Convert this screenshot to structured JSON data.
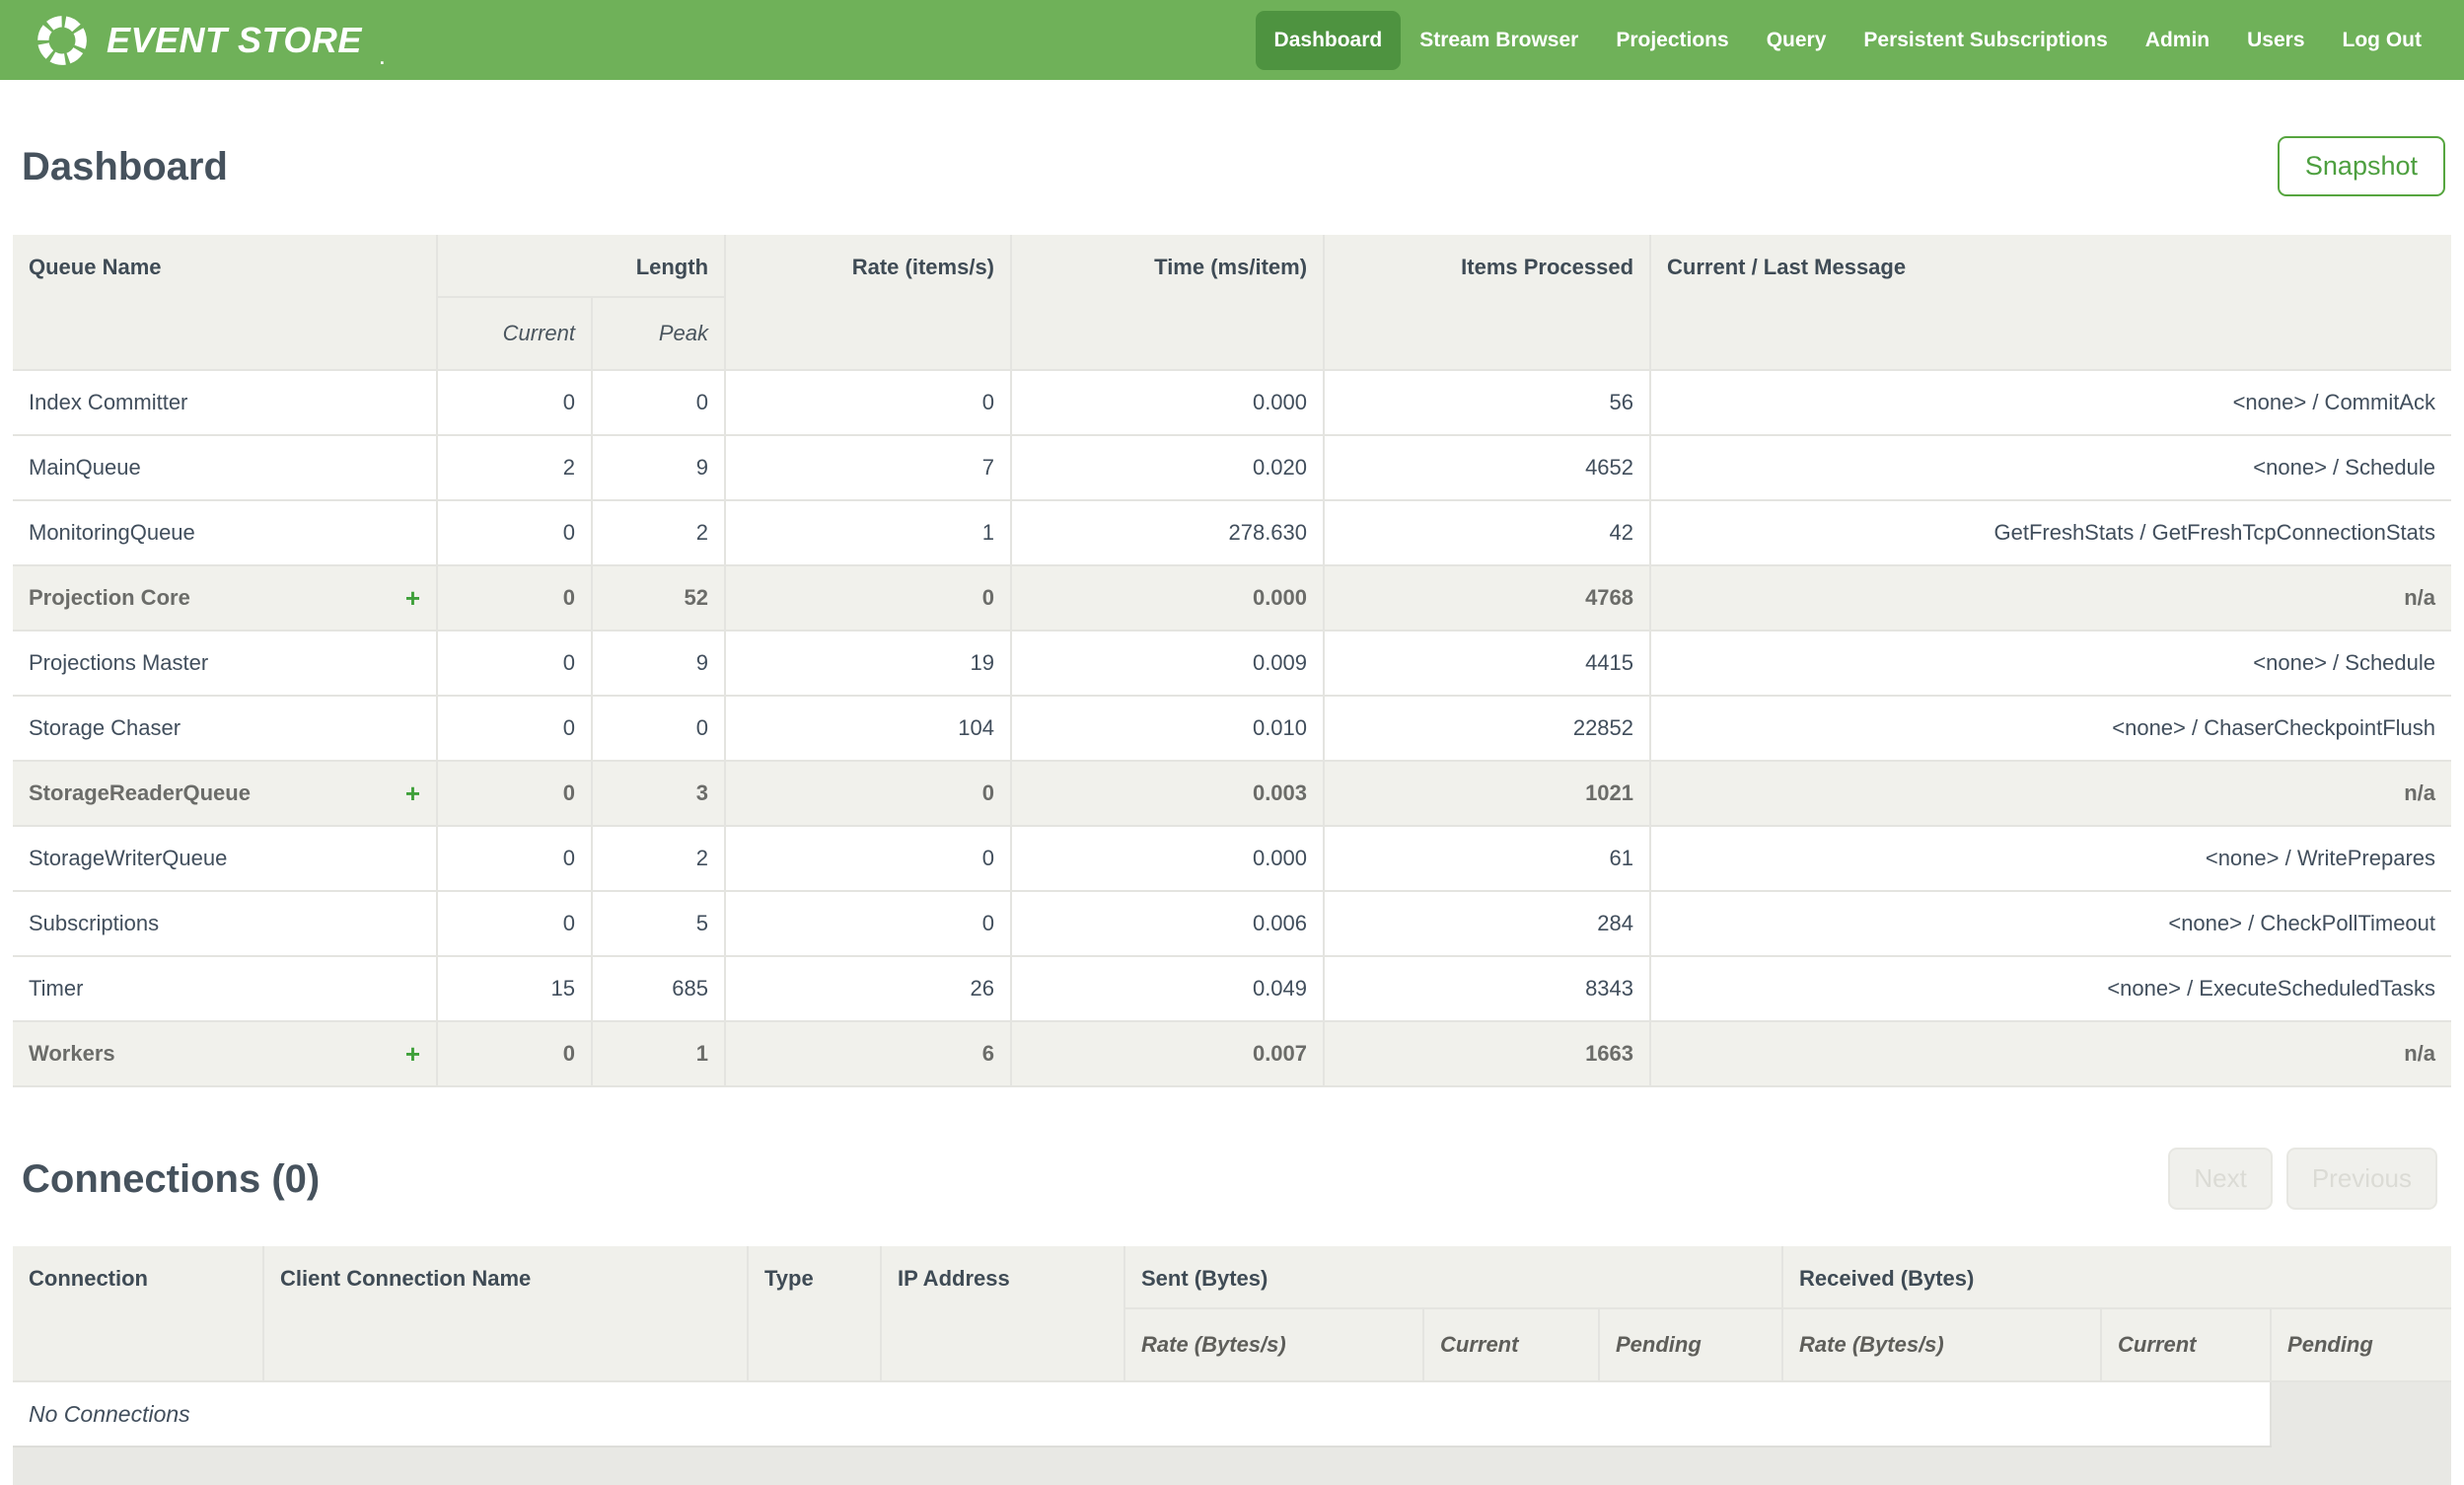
{
  "colors": {
    "nav_green": "#6FB159",
    "nav_active_green": "#4E9340",
    "accent_green": "#4D9F3F",
    "heading_text": "#46525D",
    "body_text": "#414E5C",
    "group_text": "#6B6C69",
    "header_bg": "#F0F0EB",
    "group_row_bg": "#F1F1EC"
  },
  "nav": {
    "logo_text": "EVENT STORE",
    "logo_mark": ".",
    "items": [
      {
        "label": "Dashboard",
        "active": true
      },
      {
        "label": "Stream Browser",
        "active": false
      },
      {
        "label": "Projections",
        "active": false
      },
      {
        "label": "Query",
        "active": false
      },
      {
        "label": "Persistent Subscriptions",
        "active": false
      },
      {
        "label": "Admin",
        "active": false
      },
      {
        "label": "Users",
        "active": false
      },
      {
        "label": "Log Out",
        "active": false
      }
    ]
  },
  "dashboard": {
    "title": "Dashboard",
    "snapshot_label": "Snapshot"
  },
  "queue_table": {
    "expand_symbol": "+",
    "headers": {
      "queue_name": "Queue Name",
      "length": "Length",
      "current": "Current",
      "peak": "Peak",
      "rate": "Rate (items/s)",
      "time": "Time (ms/item)",
      "items_processed": "Items Processed",
      "message": "Current / Last Message"
    },
    "rows": [
      {
        "name": "Index Committer",
        "group": false,
        "current": "0",
        "peak": "0",
        "rate": "0",
        "time": "0.000",
        "items": "56",
        "message": "<none> / CommitAck"
      },
      {
        "name": "MainQueue",
        "group": false,
        "current": "2",
        "peak": "9",
        "rate": "7",
        "time": "0.020",
        "items": "4652",
        "message": "<none> / Schedule"
      },
      {
        "name": "MonitoringQueue",
        "group": false,
        "current": "0",
        "peak": "2",
        "rate": "1",
        "time": "278.630",
        "items": "42",
        "message": "GetFreshStats / GetFreshTcpConnectionStats"
      },
      {
        "name": "Projection Core",
        "group": true,
        "current": "0",
        "peak": "52",
        "rate": "0",
        "time": "0.000",
        "items": "4768",
        "message": "n/a"
      },
      {
        "name": "Projections Master",
        "group": false,
        "current": "0",
        "peak": "9",
        "rate": "19",
        "time": "0.009",
        "items": "4415",
        "message": "<none> / Schedule"
      },
      {
        "name": "Storage Chaser",
        "group": false,
        "current": "0",
        "peak": "0",
        "rate": "104",
        "time": "0.010",
        "items": "22852",
        "message": "<none> / ChaserCheckpointFlush"
      },
      {
        "name": "StorageReaderQueue",
        "group": true,
        "current": "0",
        "peak": "3",
        "rate": "0",
        "time": "0.003",
        "items": "1021",
        "message": "n/a"
      },
      {
        "name": "StorageWriterQueue",
        "group": false,
        "current": "0",
        "peak": "2",
        "rate": "0",
        "time": "0.000",
        "items": "61",
        "message": "<none> / WritePrepares"
      },
      {
        "name": "Subscriptions",
        "group": false,
        "current": "0",
        "peak": "5",
        "rate": "0",
        "time": "0.006",
        "items": "284",
        "message": "<none> / CheckPollTimeout"
      },
      {
        "name": "Timer",
        "group": false,
        "current": "15",
        "peak": "685",
        "rate": "26",
        "time": "0.049",
        "items": "8343",
        "message": "<none> / ExecuteScheduledTasks"
      },
      {
        "name": "Workers",
        "group": true,
        "current": "0",
        "peak": "1",
        "rate": "6",
        "time": "0.007",
        "items": "1663",
        "message": "n/a"
      }
    ]
  },
  "connections": {
    "title": "Connections (0)",
    "next_label": "Next",
    "previous_label": "Previous",
    "empty_message": "No Connections",
    "headers": {
      "connection": "Connection",
      "client_name": "Client Connection Name",
      "type": "Type",
      "ip": "IP Address",
      "sent": "Sent (Bytes)",
      "received": "Received (Bytes)",
      "rate": "Rate (Bytes/s)",
      "current": "Current",
      "pending": "Pending"
    }
  }
}
